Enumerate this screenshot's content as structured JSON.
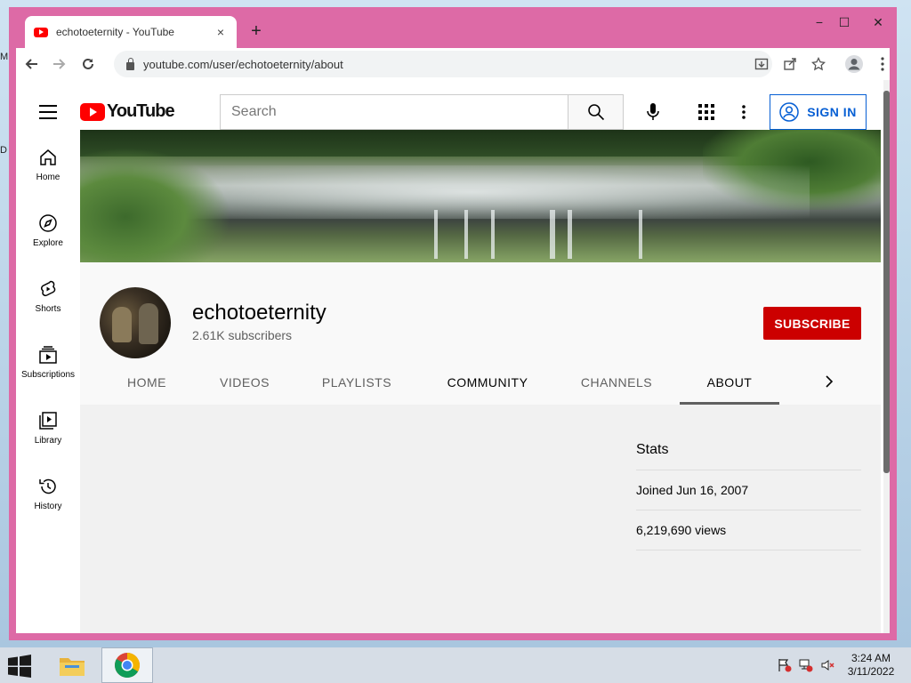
{
  "desktop": {
    "letters": [
      "M",
      "D"
    ]
  },
  "browser": {
    "tab_title": "echotoeternity - YouTube",
    "tab_close": "×",
    "new_tab": "+",
    "window_controls": {
      "minimize": "−",
      "maximize": "☐",
      "close": "✕"
    },
    "url": "youtube.com/user/echotoeternity/about"
  },
  "masthead": {
    "logo_text": "YouTube",
    "search_placeholder": "Search",
    "signin_label": "SIGN IN"
  },
  "guide": {
    "items": [
      {
        "label": "Home",
        "icon": "home-icon"
      },
      {
        "label": "Explore",
        "icon": "compass-icon"
      },
      {
        "label": "Shorts",
        "icon": "shorts-icon"
      },
      {
        "label": "Subscriptions",
        "icon": "subscriptions-icon"
      },
      {
        "label": "Library",
        "icon": "library-icon"
      },
      {
        "label": "History",
        "icon": "history-icon"
      }
    ]
  },
  "channel": {
    "name": "echotoeternity",
    "subscribers": "2.61K subscribers",
    "subscribe_label": "SUBSCRIBE",
    "subscribe_color": "#cc0000",
    "tabs": [
      {
        "label": "HOME"
      },
      {
        "label": "VIDEOS"
      },
      {
        "label": "PLAYLISTS"
      },
      {
        "label": "COMMUNITY"
      },
      {
        "label": "CHANNELS"
      },
      {
        "label": "ABOUT",
        "active": true
      }
    ]
  },
  "about": {
    "stats_title": "Stats",
    "joined": "Joined Jun 16, 2007",
    "views": "6,219,690 views"
  },
  "taskbar": {
    "time": "3:24 AM",
    "date": "3/11/2022"
  },
  "colors": {
    "window_frame": "#dd6aa6",
    "yt_red": "#ff0000",
    "link_blue": "#065fd4"
  }
}
